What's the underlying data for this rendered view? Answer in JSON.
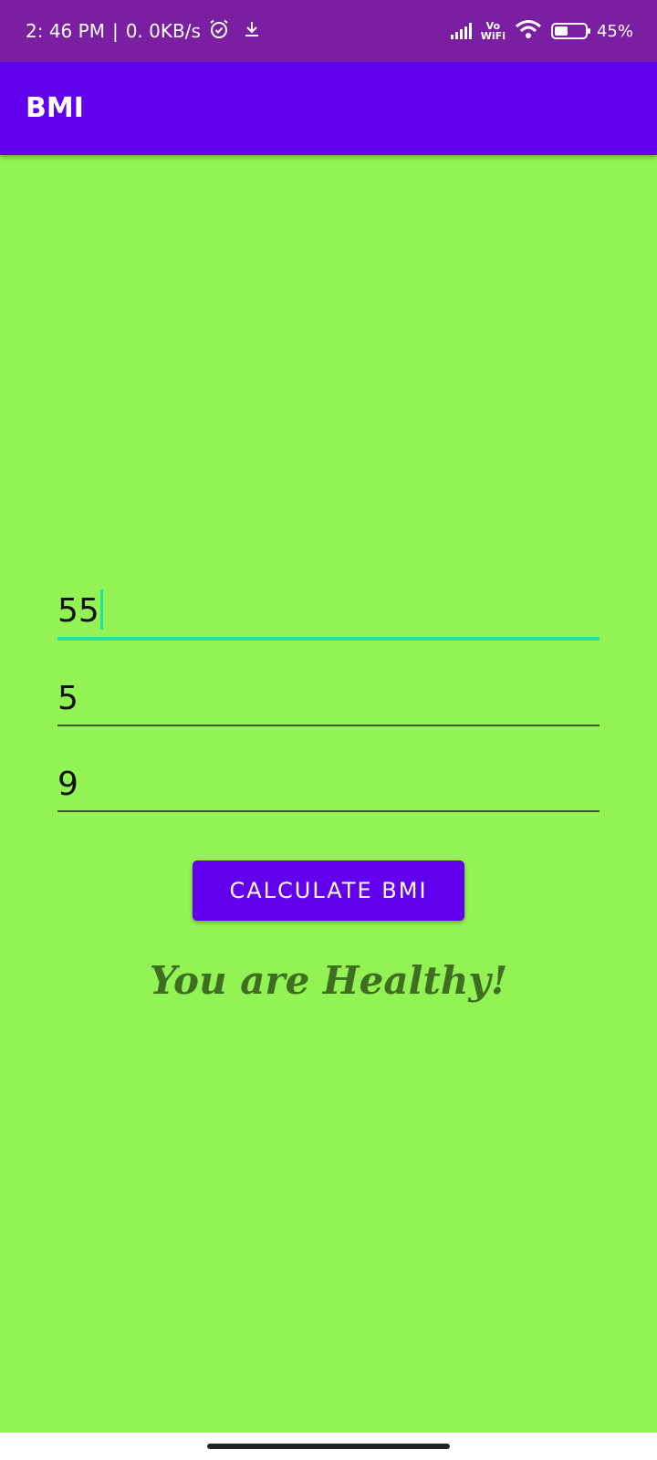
{
  "status_bar": {
    "time": "2: 46 PM",
    "separator": "|",
    "net_speed": "0. 0KB/s",
    "alarm_icon": "alarm-icon",
    "download_icon": "download-icon",
    "vo_label": "Vo",
    "wifi_label": "WiFi",
    "battery_percent": "45%",
    "battery_level": 0.45
  },
  "app_bar": {
    "title": "BMI"
  },
  "form": {
    "weight_value": "55",
    "height_feet_value": "5",
    "height_inches_value": "9",
    "calculate_label": "CALCULATE BMI"
  },
  "result": {
    "message": "You are Healthy!"
  },
  "colors": {
    "background": "#93f254",
    "status_bar": "#7b1fa2",
    "app_bar": "#6200ee",
    "accent": "#20e3a2",
    "result_text": "#3f6e22"
  }
}
